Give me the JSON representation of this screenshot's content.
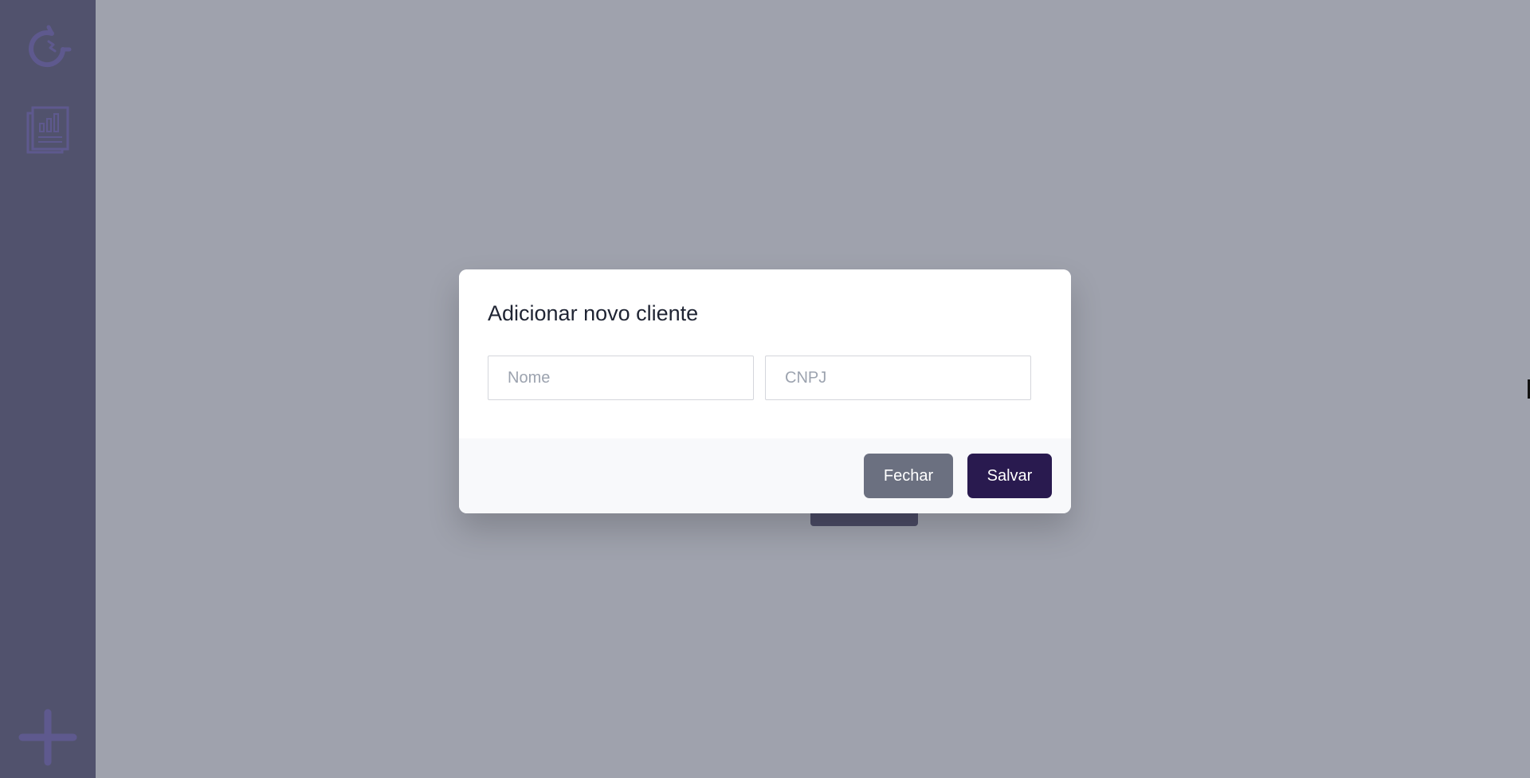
{
  "sidebar": {
    "logo_icon": "magnet-icon",
    "items": [
      {
        "icon": "reports-icon"
      }
    ],
    "add_icon": "plus-icon",
    "accent_color": "#7163b8"
  },
  "modal": {
    "title": "Adicionar novo cliente",
    "fields": {
      "nome": {
        "placeholder": "Nome",
        "value": ""
      },
      "cnpj": {
        "placeholder": "CNPJ",
        "value": ""
      }
    },
    "buttons": {
      "close_label": "Fechar",
      "save_label": "Salvar"
    }
  },
  "colors": {
    "sidebar": "#575577",
    "save_button": "#291a4f",
    "close_button": "#6b7080"
  }
}
